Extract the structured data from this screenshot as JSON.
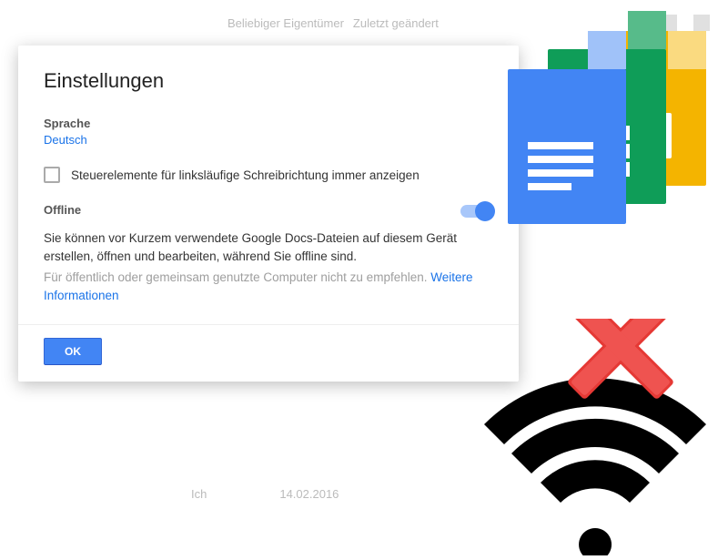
{
  "background": {
    "owner_filter": "Beliebiger Eigentümer",
    "last_modified": "Zuletzt geändert",
    "footer_owner": "Ich",
    "footer_date": "14.02.2016"
  },
  "dialog": {
    "title": "Einstellungen",
    "language_label": "Sprache",
    "language_value": "Deutsch",
    "rtl_checkbox_label": "Steuerelemente für linksläufige Schreibrichtung immer anzeigen",
    "offline_label": "Offline",
    "offline_desc": "Sie können vor Kurzem verwendete Google Docs-Dateien auf diesem Gerät erstellen, öffnen und bearbeiten, während Sie offline sind.",
    "offline_note": "Für öffentlich oder gemeinsam genutzte Computer nicht zu empfehlen. ",
    "more_info": "Weitere Informationen",
    "ok_button": "OK"
  }
}
